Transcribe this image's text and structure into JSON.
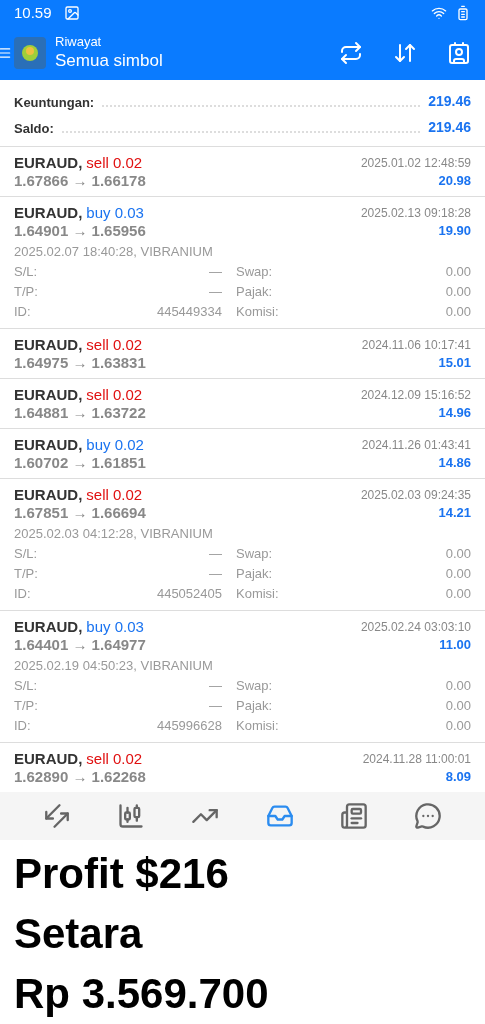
{
  "status_bar": {
    "time": "10.59"
  },
  "header": {
    "subtitle": "Riwayat",
    "title": "Semua simbol"
  },
  "summary": [
    {
      "label": "Keuntungan:",
      "value": "219.46"
    },
    {
      "label": "Saldo:",
      "value": "219.46"
    }
  ],
  "trades": [
    {
      "symbol": "EURAUD,",
      "kind": "sell",
      "volume": "sell 0.02",
      "prices": "1.67866 → 1.66178",
      "time": "2025.01.02 12:48:59",
      "profit": "20.98",
      "expanded": false
    },
    {
      "symbol": "EURAUD,",
      "kind": "buy",
      "volume": "buy 0.03",
      "prices": "1.64901 → 1.65956",
      "time": "2025.02.13 09:18:28",
      "profit": "19.90",
      "expanded": true,
      "open_info": "2025.02.07 18:40:28, VIBRANIUM",
      "details": [
        {
          "label": "S/L:",
          "value": "—",
          "label2": "Swap:",
          "value2": "0.00"
        },
        {
          "label": "T/P:",
          "value": "—",
          "label2": "Pajak:",
          "value2": "0.00"
        },
        {
          "label": "ID:",
          "value": "445449334",
          "label2": "Komisi:",
          "value2": "0.00"
        }
      ]
    },
    {
      "symbol": "EURAUD,",
      "kind": "sell",
      "volume": "sell 0.02",
      "prices": "1.64975 → 1.63831",
      "time": "2024.11.06 10:17:41",
      "profit": "15.01",
      "expanded": false
    },
    {
      "symbol": "EURAUD,",
      "kind": "sell",
      "volume": "sell 0.02",
      "prices": "1.64881 → 1.63722",
      "time": "2024.12.09 15:16:52",
      "profit": "14.96",
      "expanded": false
    },
    {
      "symbol": "EURAUD,",
      "kind": "buy",
      "volume": "buy 0.02",
      "prices": "1.60702 → 1.61851",
      "time": "2024.11.26 01:43:41",
      "profit": "14.86",
      "expanded": false
    },
    {
      "symbol": "EURAUD,",
      "kind": "sell",
      "volume": "sell 0.02",
      "prices": "1.67851 → 1.66694",
      "time": "2025.02.03 09:24:35",
      "profit": "14.21",
      "expanded": true,
      "open_info": "2025.02.03 04:12:28, VIBRANIUM",
      "details": [
        {
          "label": "S/L:",
          "value": "—",
          "label2": "Swap:",
          "value2": "0.00"
        },
        {
          "label": "T/P:",
          "value": "—",
          "label2": "Pajak:",
          "value2": "0.00"
        },
        {
          "label": "ID:",
          "value": "445052405",
          "label2": "Komisi:",
          "value2": "0.00"
        }
      ]
    },
    {
      "symbol": "EURAUD,",
      "kind": "buy",
      "volume": "buy 0.03",
      "prices": "1.64401 → 1.64977",
      "time": "2025.02.24 03:03:10",
      "profit": "11.00",
      "expanded": true,
      "open_info": "2025.02.19 04:50:23, VIBRANIUM",
      "details": [
        {
          "label": "S/L:",
          "value": "—",
          "label2": "Swap:",
          "value2": "0.00"
        },
        {
          "label": "T/P:",
          "value": "—",
          "label2": "Pajak:",
          "value2": "0.00"
        },
        {
          "label": "ID:",
          "value": "445996628",
          "label2": "Komisi:",
          "value2": "0.00"
        }
      ]
    },
    {
      "symbol": "EURAUD,",
      "kind": "sell",
      "volume": "sell 0.02",
      "prices": "1.62890 → 1.62268",
      "time": "2024.11.28 11:00:01",
      "profit": "8.09",
      "expanded": false
    }
  ],
  "nav": [
    {
      "kind": "trade",
      "selected": false
    },
    {
      "kind": "quotes",
      "selected": false
    },
    {
      "kind": "chart",
      "selected": false
    },
    {
      "kind": "history",
      "selected": true
    },
    {
      "kind": "news",
      "selected": false
    },
    {
      "kind": "chat",
      "selected": false
    }
  ],
  "caption": [
    "Profit $216",
    "Setara",
    "Rp 3.569.700"
  ]
}
